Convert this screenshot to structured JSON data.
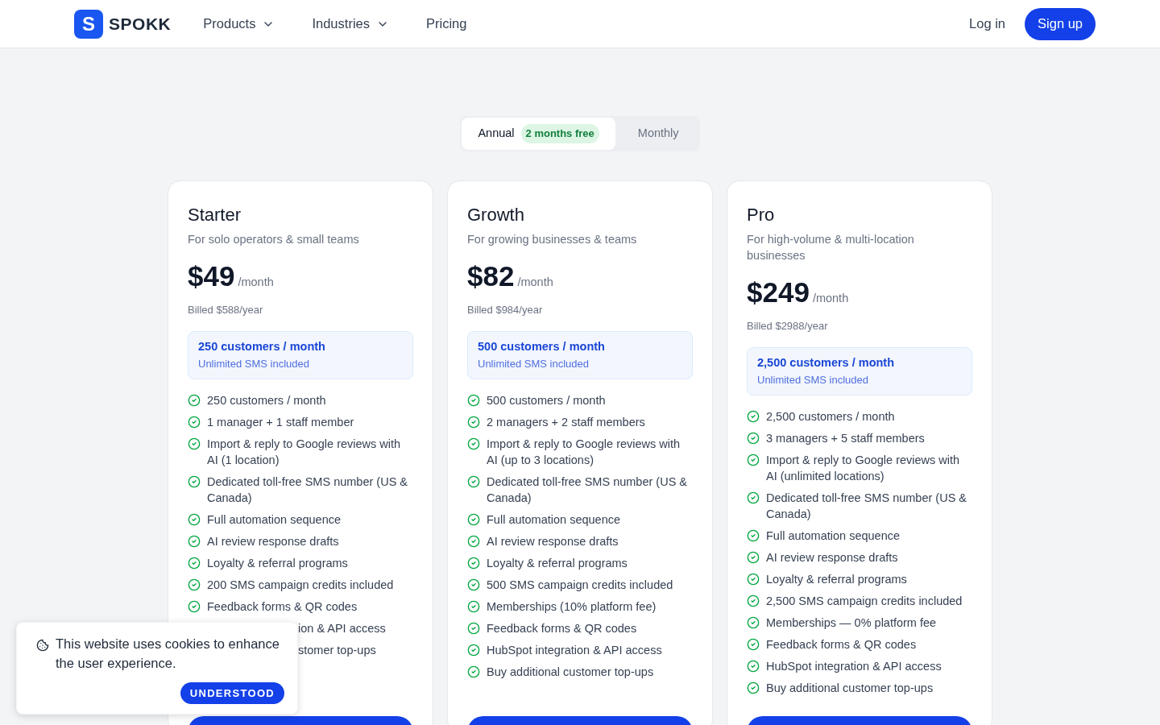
{
  "header": {
    "logo_letter": "S",
    "brand": "SPOKK",
    "nav": [
      {
        "label": "Products",
        "dropdown": true
      },
      {
        "label": "Industries",
        "dropdown": true
      },
      {
        "label": "Pricing",
        "dropdown": false
      }
    ],
    "login": "Log in",
    "signup": "Sign up"
  },
  "billing_toggle": [
    {
      "label": "Annual",
      "badge": "2 months free",
      "selected": true
    },
    {
      "label": "Monthly",
      "selected": false
    }
  ],
  "plans": [
    {
      "name": "Starter",
      "subtitle": "For solo operators & small teams",
      "price": "$49",
      "period": "/month",
      "billed": "Billed $588/year",
      "quota": "250 customers / month",
      "quota_note": "Unlimited SMS included",
      "features": [
        {
          "kind": "check",
          "text": "250 customers / month"
        },
        {
          "kind": "check",
          "text": "1 manager + 1 staff member"
        },
        {
          "kind": "check",
          "text": "Import & reply to Google reviews with AI (1 location)"
        },
        {
          "kind": "check",
          "text": "Dedicated toll-free SMS number (US & Canada)"
        },
        {
          "kind": "check",
          "text": "Full automation sequence"
        },
        {
          "kind": "check",
          "text": "AI review response drafts"
        },
        {
          "kind": "check",
          "text": "Loyalty & referral programs"
        },
        {
          "kind": "check",
          "text": "200 SMS campaign credits included"
        },
        {
          "kind": "check",
          "text": "Feedback forms & QR codes"
        },
        {
          "kind": "partial",
          "text": "ion & API access"
        },
        {
          "kind": "partial",
          "text": "stomer top-ups"
        }
      ]
    },
    {
      "name": "Growth",
      "subtitle": "For growing businesses & teams",
      "price": "$82",
      "period": "/month",
      "billed": "Billed $984/year",
      "quota": "500 customers / month",
      "quota_note": "Unlimited SMS included",
      "features": [
        {
          "kind": "check",
          "text": "500 customers / month"
        },
        {
          "kind": "check",
          "text": "2 managers + 2 staff members"
        },
        {
          "kind": "check",
          "text": "Import & reply to Google reviews with AI (up to 3 locations)"
        },
        {
          "kind": "check",
          "text": "Dedicated toll-free SMS number (US & Canada)"
        },
        {
          "kind": "check",
          "text": "Full automation sequence"
        },
        {
          "kind": "check",
          "text": "AI review response drafts"
        },
        {
          "kind": "check",
          "text": "Loyalty & referral programs"
        },
        {
          "kind": "check",
          "text": "500 SMS campaign credits included"
        },
        {
          "kind": "check",
          "text": "Memberships (10% platform fee)"
        },
        {
          "kind": "check",
          "text": "Feedback forms & QR codes"
        },
        {
          "kind": "check",
          "text": "HubSpot integration & API access"
        },
        {
          "kind": "check",
          "text": "Buy additional customer top-ups"
        }
      ]
    },
    {
      "name": "Pro",
      "subtitle": "For high-volume & multi-location businesses",
      "price": "$249",
      "period": "/month",
      "billed": "Billed $2988/year",
      "quota": "2,500 customers / month",
      "quota_note": "Unlimited SMS included",
      "features": [
        {
          "kind": "check",
          "text": "2,500 customers / month"
        },
        {
          "kind": "check",
          "text": "3 managers + 5 staff members"
        },
        {
          "kind": "check",
          "text": "Import & reply to Google reviews with AI (unlimited locations)"
        },
        {
          "kind": "check",
          "text": "Dedicated toll-free SMS number (US & Canada)"
        },
        {
          "kind": "check",
          "text": "Full automation sequence"
        },
        {
          "kind": "check",
          "text": "AI review response drafts"
        },
        {
          "kind": "check",
          "text": "Loyalty & referral programs"
        },
        {
          "kind": "check",
          "text": "2,500 SMS campaign credits included"
        },
        {
          "kind": "check",
          "text": "Memberships — 0% platform fee"
        },
        {
          "kind": "check",
          "text": "Feedback forms & QR codes"
        },
        {
          "kind": "check",
          "text": "HubSpot integration & API access"
        },
        {
          "kind": "check",
          "text": "Buy additional customer top-ups"
        }
      ]
    }
  ],
  "cookie_banner": {
    "message": "This website uses cookies to enhance the user experience.",
    "button": "UNDERSTOOD"
  }
}
